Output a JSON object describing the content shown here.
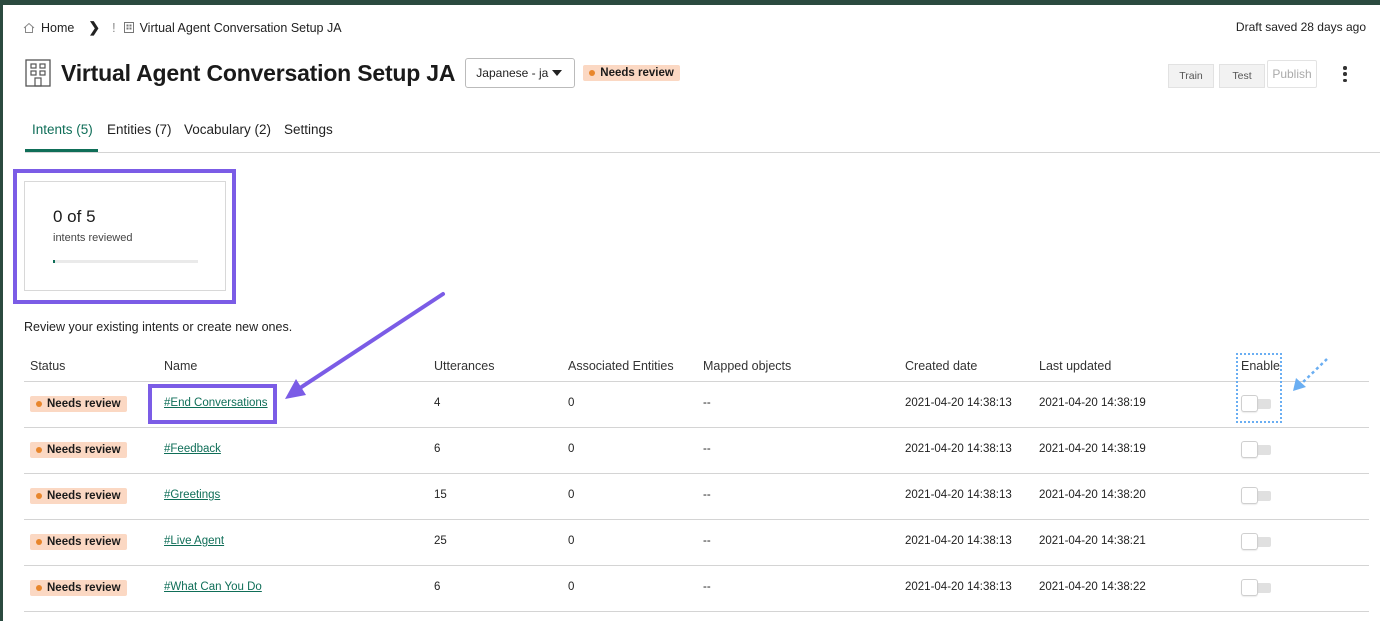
{
  "breadcrumb": {
    "home": "Home",
    "current_prefix": "!",
    "current": "Virtual Agent Conversation Setup JA"
  },
  "draft_status": "Draft saved 28 days ago",
  "header": {
    "title": "Virtual Agent Conversation Setup JA",
    "language": "Japanese - ja",
    "status_badge": "Needs review"
  },
  "toolbar": {
    "train_label": "Train",
    "test_label": "Test",
    "publish_label": "Publish"
  },
  "tabs": [
    {
      "label": "Intents (5)",
      "active": true
    },
    {
      "label": "Entities (7)",
      "active": false
    },
    {
      "label": "Vocabulary (2)",
      "active": false
    },
    {
      "label": "Settings",
      "active": false
    }
  ],
  "summary": {
    "count": "0 of 5",
    "label": "intents reviewed",
    "progress_fraction": 0
  },
  "intro_text": "Review your existing intents or create new ones.",
  "table": {
    "headers": [
      "Status",
      "Name",
      "Utterances",
      "Associated Entities",
      "Mapped objects",
      "Created date",
      "Last updated",
      "Enable"
    ],
    "rows": [
      {
        "status": "Needs review",
        "name": "#End Conversations",
        "utterances": "4",
        "entities": "0",
        "mapped": "--",
        "created": "2021-04-20 14:38:13",
        "updated": "2021-04-20 14:38:19",
        "enabled": false
      },
      {
        "status": "Needs review",
        "name": "#Feedback",
        "utterances": "6",
        "entities": "0",
        "mapped": "--",
        "created": "2021-04-20 14:38:13",
        "updated": "2021-04-20 14:38:19",
        "enabled": false
      },
      {
        "status": "Needs review",
        "name": "#Greetings",
        "utterances": "15",
        "entities": "0",
        "mapped": "--",
        "created": "2021-04-20 14:38:13",
        "updated": "2021-04-20 14:38:20",
        "enabled": false
      },
      {
        "status": "Needs review",
        "name": "#Live Agent",
        "utterances": "25",
        "entities": "0",
        "mapped": "--",
        "created": "2021-04-20 14:38:13",
        "updated": "2021-04-20 14:38:21",
        "enabled": false
      },
      {
        "status": "Needs review",
        "name": "#What Can You Do",
        "utterances": "6",
        "entities": "0",
        "mapped": "--",
        "created": "2021-04-20 14:38:13",
        "updated": "2021-04-20 14:38:22",
        "enabled": false
      }
    ]
  },
  "colors": {
    "accent": "#0f6e58",
    "badge_bg": "#fbd8c3",
    "badge_dot": "#e8862c",
    "annotation_purple": "#7b5ce6",
    "annotation_blue": "#6aaef2"
  },
  "icons": {
    "home": "home-icon",
    "breadcrumb_separator": "chevron-right-icon",
    "page": "building-icon",
    "dropdown": "caret-down-icon",
    "more": "kebab-menu-icon"
  }
}
